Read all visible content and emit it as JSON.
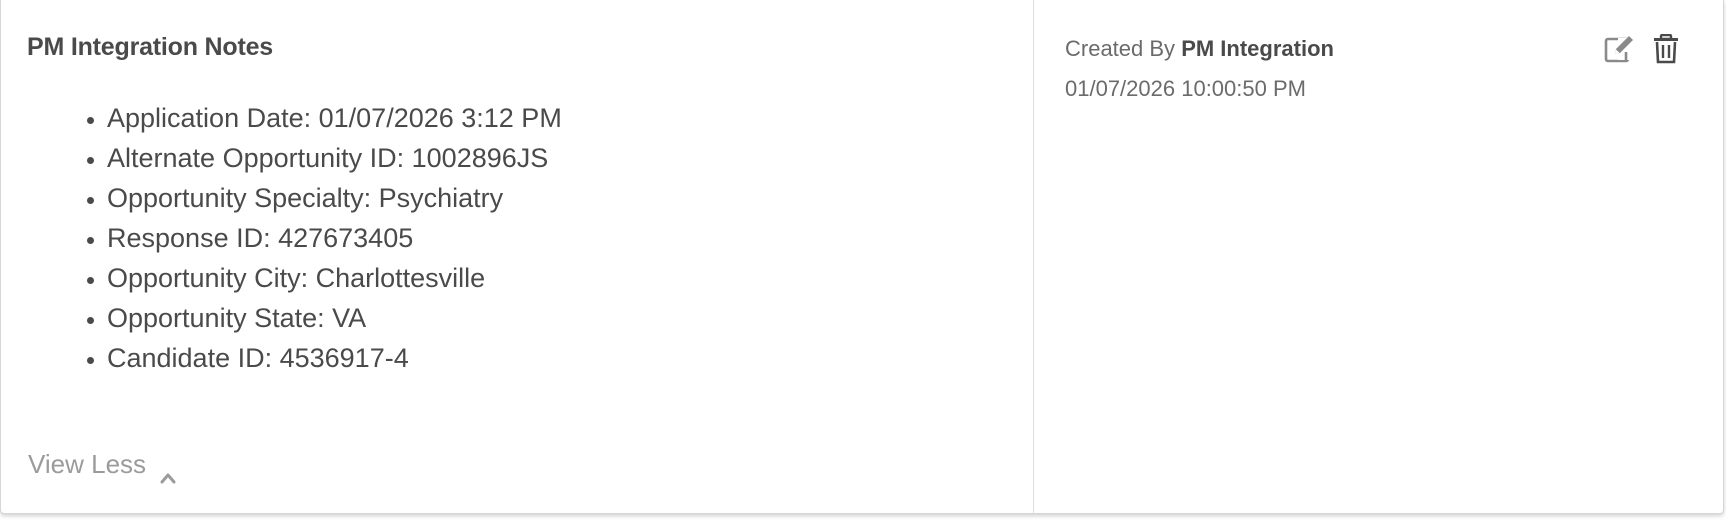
{
  "note": {
    "title": "PM Integration Notes",
    "items": [
      "Application Date: 01/07/2026 3:12 PM",
      "Alternate Opportunity ID: 1002896JS",
      "Opportunity Specialty: Psychiatry",
      "Response ID: 427673405",
      "Opportunity City: Charlottesville",
      "Opportunity State: VA",
      "Candidate ID: 4536917-4"
    ],
    "toggle_label": "View Less",
    "toggle_icon": "chevron-up-icon"
  },
  "meta": {
    "created_by_prefix": "Created By",
    "created_by_name": "PM Integration",
    "timestamp": "01/07/2026 10:00:50 PM"
  },
  "actions": {
    "edit_icon": "edit-icon",
    "delete_icon": "trash-icon"
  },
  "colors": {
    "text": "#4a4a4a",
    "muted": "#9b9b9b",
    "icon": "#4a4a4a",
    "edit_icon": "#8a8a8a"
  }
}
